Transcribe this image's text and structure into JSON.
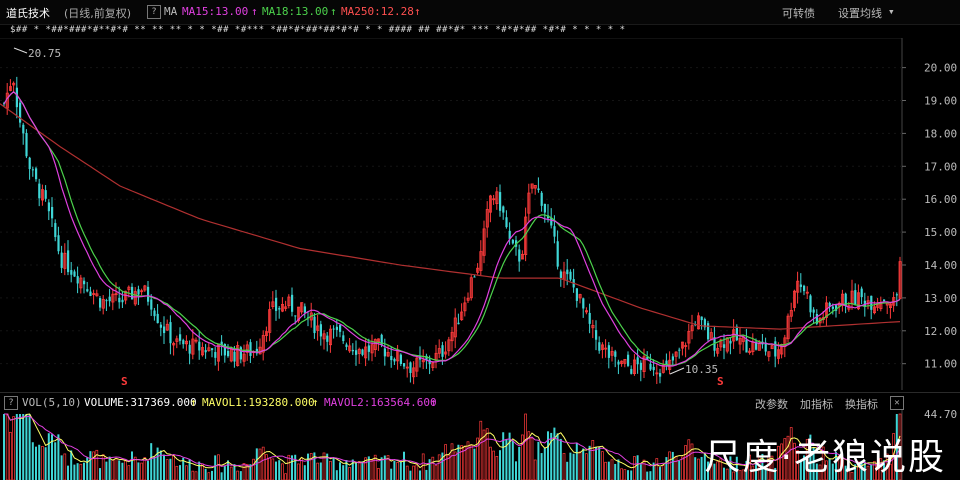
{
  "header": {
    "stock_name": "道氏技术",
    "period": "(日线,前复权)",
    "help_icon": "?",
    "ma_label": "MA",
    "ma15": "MA15:13.00",
    "ma18": "MA18:13.00",
    "ma250": "MA250:12.28",
    "arrow_up": "↑",
    "convertible_bond": "可转债",
    "set_ma_line": "设置均线",
    "dropdown_icon": "▾"
  },
  "tick_marks": "$## * *##*###*#**#*# ** ** ** * * *## *#*** *##*#*##*##*#*# * * #### ## ##*#* *** *#*#*## *#*# * * * * *",
  "annotations": {
    "high_label": "20.75",
    "low_label": "10.35",
    "signal_marker": "S"
  },
  "price_axis": [
    "20.00",
    "19.00",
    "18.00",
    "17.00",
    "16.00",
    "15.00",
    "14.00",
    "13.00",
    "12.00",
    "11.00"
  ],
  "volume_header": {
    "help_icon": "?",
    "vol_label": "VOL(5,10)",
    "volume": "VOLUME:317369.000",
    "mavol1": "MAVOL1:193280.000",
    "mavol2": "MAVOL2:163564.600",
    "arrow_up": "↑",
    "change_params": "改参数",
    "add_indicator": "加指标",
    "switch_indicator": "换指标",
    "close_icon": "✕"
  },
  "volume_axis": [
    "44.70"
  ],
  "watermark": "尺度·老狼说股",
  "colors": {
    "up": "#ff3b3b",
    "down": "#3fd6d6",
    "ma15": "#e040e0",
    "ma18": "#4cd24c",
    "ma250": "#b03030",
    "mavol1": "#ffff66",
    "mavol2": "#e040e0"
  },
  "chart_data": {
    "type": "candlestick",
    "ylim": [
      10.2,
      20.9
    ],
    "high": 20.75,
    "low": 10.35,
    "last_close": 14.5,
    "ma": {
      "MA15": 13.0,
      "MA18": 13.0,
      "MA250": 12.28
    },
    "volume": 317369.0,
    "mavol1": 193280.0,
    "mavol2": 163564.6
  }
}
